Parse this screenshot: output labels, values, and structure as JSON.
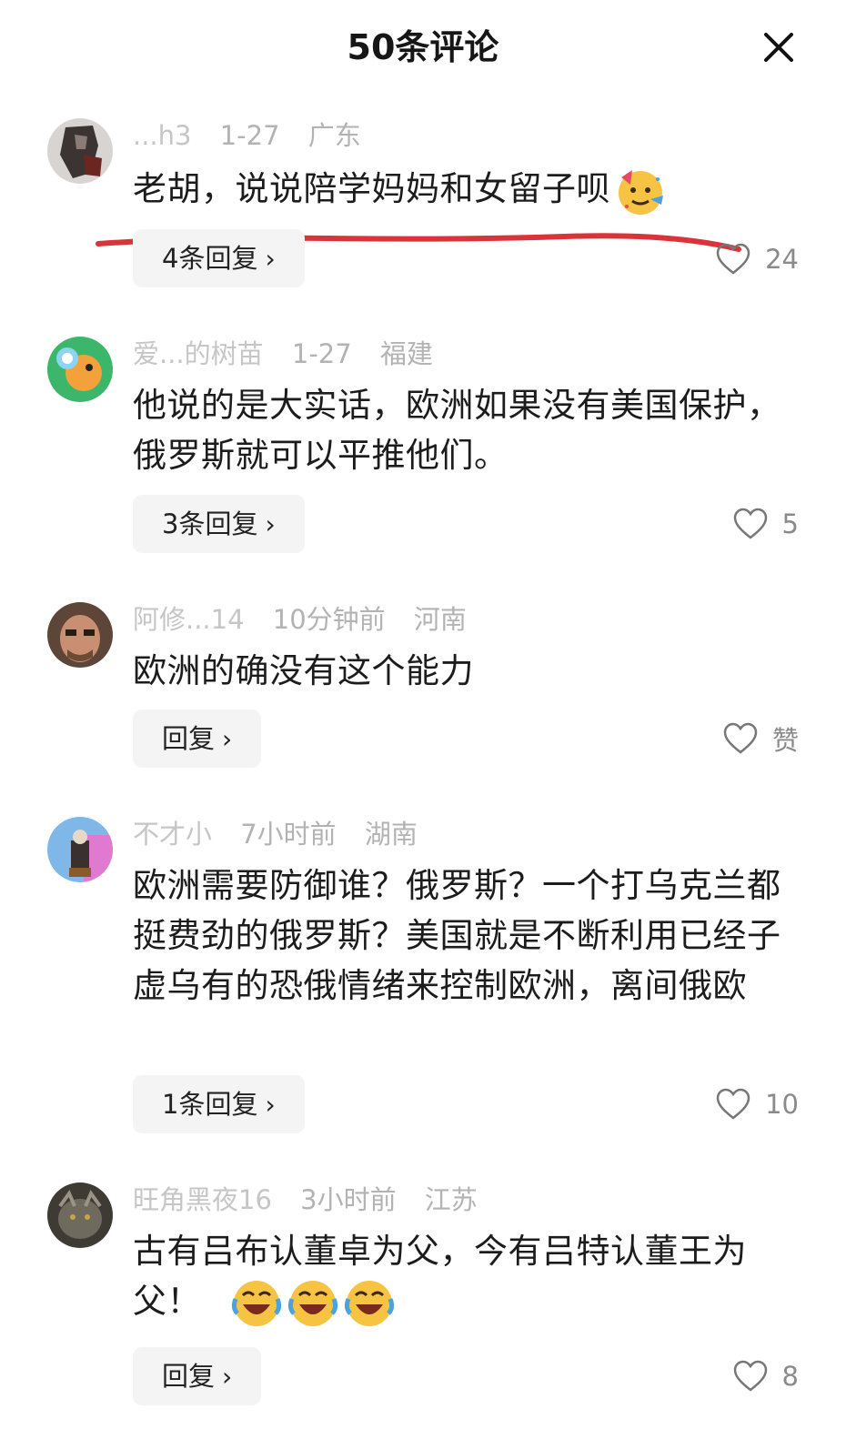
{
  "header": {
    "title": "50条评论",
    "close_icon": "close-icon"
  },
  "comments": [
    {
      "username": "...h3",
      "date": "1-27",
      "location": "广东",
      "text": "老胡，说说陪学妈妈和女留子呗",
      "emoji": "partying-face-emoji",
      "reply_label": "4条回复",
      "likes": "24"
    },
    {
      "username": "爱...的树苗",
      "date": "1-27",
      "location": "福建",
      "text": "他说的是大实话，欧洲如果没有美国保护，俄罗斯就可以平推他们。",
      "reply_label": "3条回复",
      "likes": "5"
    },
    {
      "username": "阿修...14",
      "date": "10分钟前",
      "location": "河南",
      "text": "欧洲的确没有这个能力",
      "reply_label": "回复",
      "likes": "赞"
    },
    {
      "username": "不才小",
      "date": "7小时前",
      "location": "湖南",
      "text": "欧洲需要防御谁？俄罗斯？一个打乌克兰都挺费劲的俄罗斯？美国就是不断利用已经子虚乌有的恐俄情绪来控制欧洲，离间俄欧",
      "reply_label": "1条回复",
      "likes": "10"
    },
    {
      "username": "旺角黑夜16",
      "date": "3小时前",
      "location": "江苏",
      "text": "古有吕布认董卓为父，今有吕特认董王为父！",
      "emoji": "rolling-laughing-emoji",
      "reply_label": "回复",
      "likes": "8"
    }
  ],
  "colors": {
    "annotation_red": "#d9343a",
    "meta_gray": "#b3b3b3",
    "button_bg": "#f4f4f4"
  }
}
